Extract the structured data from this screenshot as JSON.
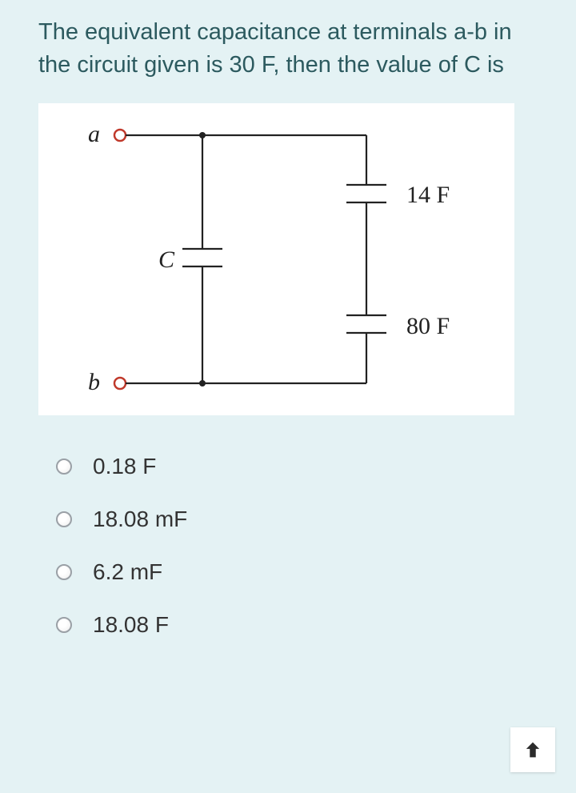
{
  "question": "The equivalent capacitance at terminals a-b in the circuit given is 30 F, then the value of C is",
  "circuit": {
    "terminals": {
      "a": "a",
      "b": "b"
    },
    "c_label": "C",
    "caps": {
      "top_right": "14 F",
      "bottom_right": "80 F"
    }
  },
  "options": [
    {
      "label": "0.18 F"
    },
    {
      "label": "18.08 mF"
    },
    {
      "label": "6.2 mF"
    },
    {
      "label": "18.08 F"
    }
  ]
}
